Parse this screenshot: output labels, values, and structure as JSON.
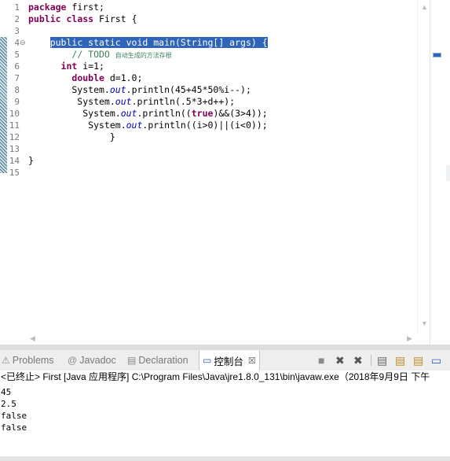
{
  "editor": {
    "line_numbers": [
      "1",
      "2",
      "3",
      "4",
      "5",
      "6",
      "7",
      "8",
      "9",
      "10",
      "11",
      "12",
      "13",
      "14",
      "15"
    ],
    "fold_marker": "⊖",
    "lines": [
      {
        "segments": [
          {
            "t": "package",
            "c": "kw"
          },
          {
            "t": " first;"
          }
        ]
      },
      {
        "segments": [
          {
            "t": "public",
            "c": "kw"
          },
          {
            "t": " "
          },
          {
            "t": "class",
            "c": "kw"
          },
          {
            "t": " First {"
          }
        ]
      },
      {
        "segments": []
      },
      {
        "segments": [
          {
            "t": "    "
          },
          {
            "t": "public static void main(String[] args) {",
            "c": "hl"
          }
        ]
      },
      {
        "segments": [
          {
            "t": "        "
          },
          {
            "t": "// TODO ",
            "c": "cm"
          },
          {
            "t": "自动生成的方法存根",
            "c": "cm-small"
          }
        ]
      },
      {
        "segments": [
          {
            "t": "      "
          },
          {
            "t": "int",
            "c": "kw"
          },
          {
            "t": " i=1;"
          }
        ]
      },
      {
        "segments": [
          {
            "t": "        "
          },
          {
            "t": "double",
            "c": "kw"
          },
          {
            "t": " d=1.0;"
          }
        ]
      },
      {
        "segments": [
          {
            "t": "        System."
          },
          {
            "t": "out",
            "c": "fld"
          },
          {
            "t": ".println(45+45*50%i--);"
          }
        ]
      },
      {
        "segments": [
          {
            "t": "         System."
          },
          {
            "t": "out",
            "c": "fld"
          },
          {
            "t": ".println(.5*3+d++);"
          }
        ]
      },
      {
        "segments": [
          {
            "t": "          System."
          },
          {
            "t": "out",
            "c": "fld"
          },
          {
            "t": ".println(("
          },
          {
            "t": "true",
            "c": "kw"
          },
          {
            "t": ")&&(3>4));"
          }
        ]
      },
      {
        "segments": [
          {
            "t": "           System."
          },
          {
            "t": "out",
            "c": "fld"
          },
          {
            "t": ".println((i>0)||(i<0));"
          }
        ]
      },
      {
        "segments": [
          {
            "t": "               }"
          }
        ]
      },
      {
        "segments": []
      },
      {
        "segments": [
          {
            "t": "}"
          }
        ]
      },
      {
        "segments": []
      }
    ]
  },
  "panel": {
    "tabs": [
      {
        "label": "Problems",
        "icon": "⚠"
      },
      {
        "label": "Javadoc",
        "icon": "@"
      },
      {
        "label": "Declaration",
        "icon": "▤"
      },
      {
        "label": "控制台",
        "icon": "▭",
        "close": "☒"
      }
    ],
    "toolbar_icons": [
      "■",
      "✖",
      "✖",
      "▤",
      "▤",
      "▤",
      "▭"
    ]
  },
  "console": {
    "status": "<已终止> First [Java 应用程序] C:\\Program Files\\Java\\jre1.8.0_131\\bin\\javaw.exe（2018年9月9日 下午",
    "output": [
      "45",
      "2.5",
      "false",
      "false"
    ]
  }
}
